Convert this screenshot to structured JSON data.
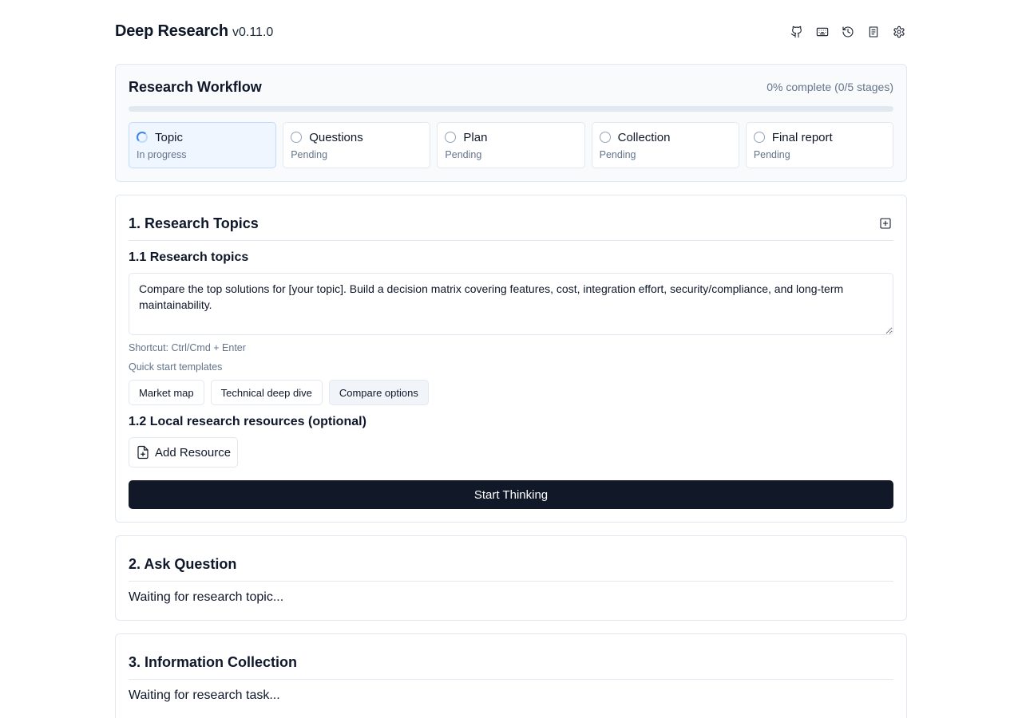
{
  "header": {
    "title": "Deep Research",
    "version": "v0.11.0",
    "icons": [
      "github-icon",
      "keyboard-icon",
      "history-icon",
      "book-icon",
      "settings-icon"
    ]
  },
  "workflow": {
    "title": "Research Workflow",
    "progress_text": "0% complete (0/5 stages)",
    "progress_fraction": 0,
    "stages": [
      {
        "name": "Topic",
        "status": "In progress"
      },
      {
        "name": "Questions",
        "status": "Pending"
      },
      {
        "name": "Plan",
        "status": "Pending"
      },
      {
        "name": "Collection",
        "status": "Pending"
      },
      {
        "name": "Final report",
        "status": "Pending"
      }
    ]
  },
  "topics": {
    "title": "1. Research Topics",
    "sub1": "1.1 Research topics",
    "input_value": "Compare the top solutions for [your topic]. Build a decision matrix covering features, cost, integration effort, security/compliance, and long-term maintainability.",
    "shortcut_hint": "Shortcut: Ctrl/Cmd + Enter",
    "templates_label": "Quick start templates",
    "templates": [
      "Market map",
      "Technical deep dive",
      "Compare options"
    ],
    "sub2": "1.2 Local research resources (optional)",
    "add_resource": "Add Resource",
    "start_button": "Start Thinking"
  },
  "ask": {
    "title": "2. Ask Question",
    "waiting": "Waiting for research topic..."
  },
  "collection": {
    "title": "3. Information Collection",
    "waiting": "Waiting for research task..."
  },
  "colors": {
    "accent": "#3b82f6",
    "primary_button": "#111827",
    "active_stage_bg": "#eff6ff"
  }
}
